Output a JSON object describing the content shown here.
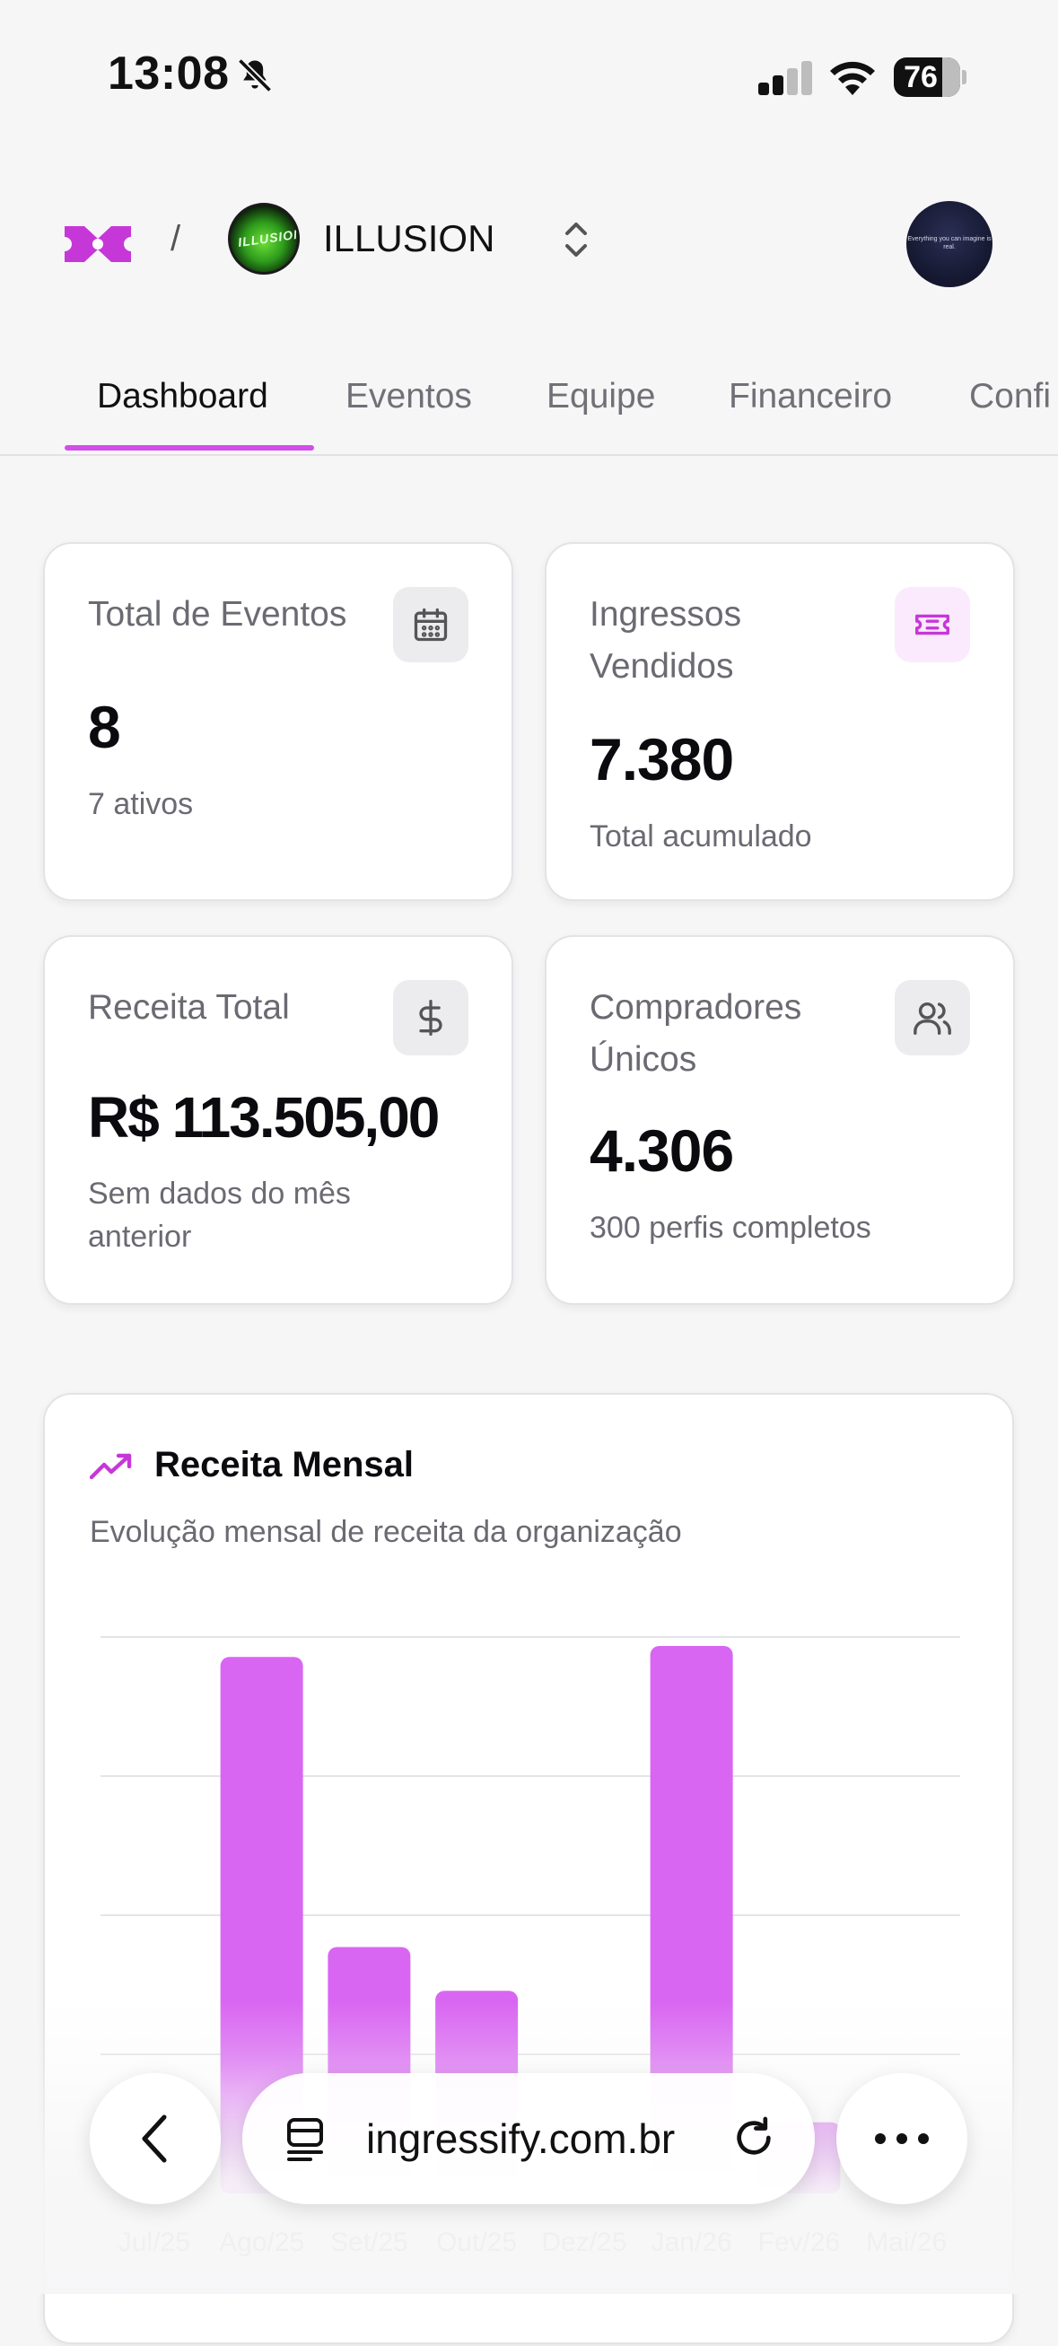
{
  "status_bar": {
    "time": "13:08",
    "battery": "76"
  },
  "header": {
    "separator": "/",
    "org_name": "ILLUSION",
    "org_logo_text": "ILLUSION",
    "user_avatar_text": "Everything you can imagine is real."
  },
  "tabs": [
    {
      "label": "Dashboard",
      "active": true
    },
    {
      "label": "Eventos",
      "active": false
    },
    {
      "label": "Equipe",
      "active": false
    },
    {
      "label": "Financeiro",
      "active": false
    },
    {
      "label": "Confi",
      "active": false
    }
  ],
  "stats": [
    {
      "title": "Total de Eventos",
      "value": "8",
      "subtitle": "7 ativos",
      "icon": "calendar-icon"
    },
    {
      "title": "Ingressos Vendidos",
      "value": "7.380",
      "subtitle": "Total acumulado",
      "icon": "ticket-icon"
    },
    {
      "title": "Receita Total",
      "value": "R$ 113.505,00",
      "subtitle": "Sem dados do mês anterior",
      "icon": "dollar-icon"
    },
    {
      "title": "Compradores Únicos",
      "value": "4.306",
      "subtitle": "300 perfis completos",
      "icon": "users-icon"
    }
  ],
  "chart": {
    "title": "Receita Mensal",
    "description": "Evolução mensal de receita da organização"
  },
  "chart_data": {
    "type": "bar",
    "title": "Receita Mensal",
    "categories": [
      "Jul/25",
      "Ago/25",
      "Set/25",
      "Out/25",
      "Dez/25",
      "Jan/26",
      "Fev/26",
      "Mai/26"
    ],
    "values": [
      0.0,
      0.98,
      0.45,
      0.37,
      0.0,
      1.0,
      0.13,
      0.0
    ],
    "value_unit": "fraction of tallest bar (y-axis not visible)",
    "color": "#d966f2",
    "grid": true
  },
  "browser": {
    "url": "ingressify.com.br"
  },
  "colors": {
    "accent": "#d24ee8",
    "bar": "#d966f2",
    "background": "#f6f6f7"
  }
}
